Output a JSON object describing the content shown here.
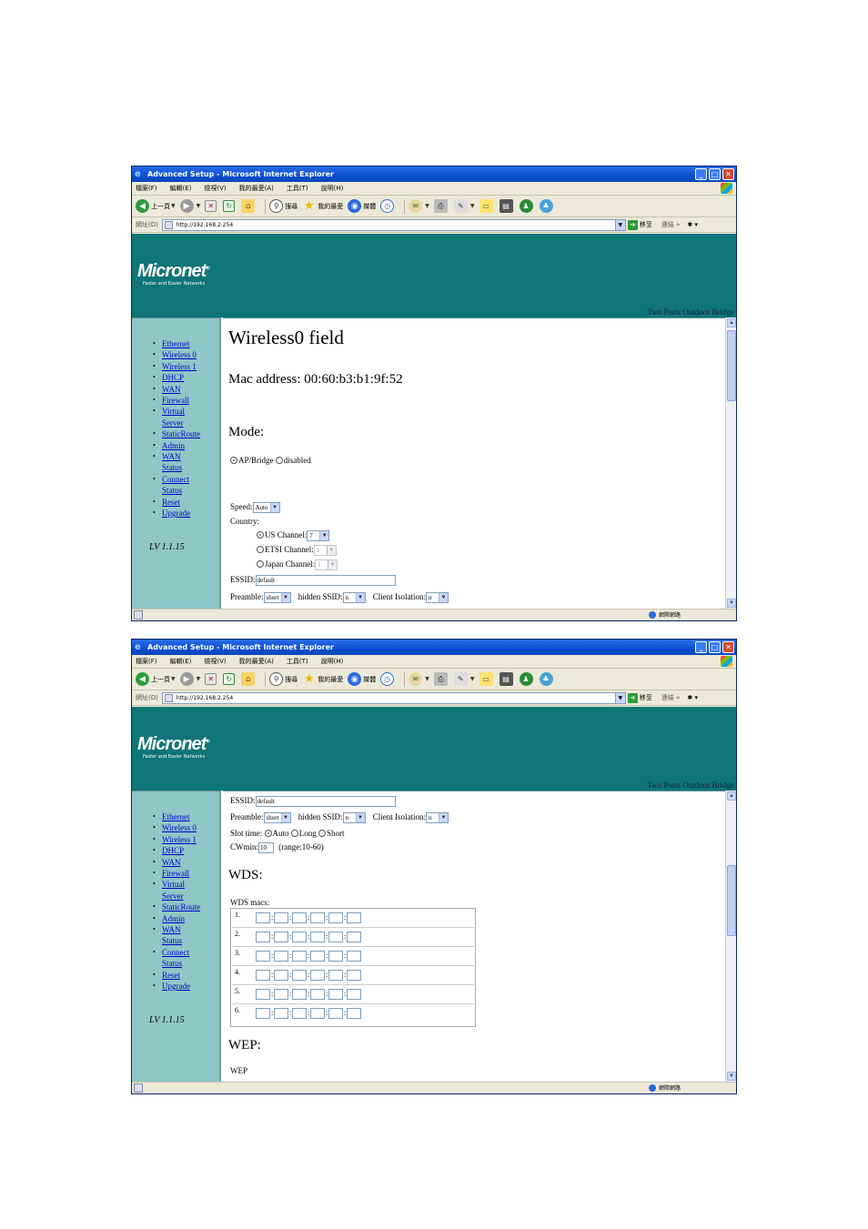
{
  "browser": {
    "title": "Advanced Setup - Microsoft Internet Explorer",
    "menu": [
      "檔案(F)",
      "編輯(E)",
      "檢視(V)",
      "我的最愛(A)",
      "工具(T)",
      "說明(H)"
    ],
    "back_label": "上一頁",
    "search_label": "搜尋",
    "favorites_label": "我的最愛",
    "media_label": "媒體",
    "address_label": "網址(D)",
    "url": "http://192.168.2.254",
    "go_label": "移至",
    "links_label": "連結",
    "status_zone": "網際網路"
  },
  "banner": {
    "logo": "Micronet",
    "tagline": "Faster and Easier Networks",
    "product": "Two Ports Outdoor Bridge"
  },
  "nav": [
    "Ethernet",
    "Wireless 0",
    "Wireless 1",
    "DHCP",
    "WAN",
    "Firewall",
    "Virtual Server",
    "StaticRoute",
    "Admin",
    "WAN Status",
    "Connect Status",
    "Reset",
    "Upgrade"
  ],
  "version": "LV 1.1.15",
  "page1": {
    "title": "Wireless0 field",
    "mac_label": "Mac address: 00:60:b3:b1:9f:52",
    "mode_heading": "Mode:",
    "mode_options": [
      "AP/Bridge",
      "disabled"
    ],
    "speed_label": "Speed:",
    "speed_value": "Auto",
    "country_label": "Country:",
    "us_channel_label": "US Channel:",
    "us_channel_value": "7",
    "etsi_channel_label": "ETSI Channel:",
    "etsi_channel_value": "1",
    "japan_channel_label": "Japan Channel:",
    "japan_channel_value": "1",
    "essid_label": "ESSID:",
    "essid_value": "default",
    "preamble_label": "Preamble:",
    "preamble_value": "short",
    "hidden_ssid_label": "hidden SSID:",
    "hidden_ssid_value": "n",
    "client_isolation_label": "Client Isolation:",
    "client_isolation_value": "n"
  },
  "page2": {
    "essid_label": "ESSID:",
    "essid_value": "default",
    "preamble_label": "Preamble:",
    "preamble_value": "short",
    "hidden_ssid_label": "hidden SSID:",
    "hidden_ssid_value": "n",
    "client_isolation_label": "Client Isolation:",
    "client_isolation_value": "n",
    "slot_time_label": "Slot time:",
    "slot_options": [
      "Auto",
      "Long",
      "Short"
    ],
    "cwmin_label": "CWmin:",
    "cwmin_value": "10",
    "cwmin_range": "(range:10-60)",
    "wds_heading": "WDS:",
    "wds_macs_label": "WDS macs:",
    "wds_rows": [
      "1.",
      "2.",
      "3.",
      "4.",
      "5.",
      "6."
    ],
    "wep_heading": "WEP:",
    "wep_label": "WEP"
  }
}
